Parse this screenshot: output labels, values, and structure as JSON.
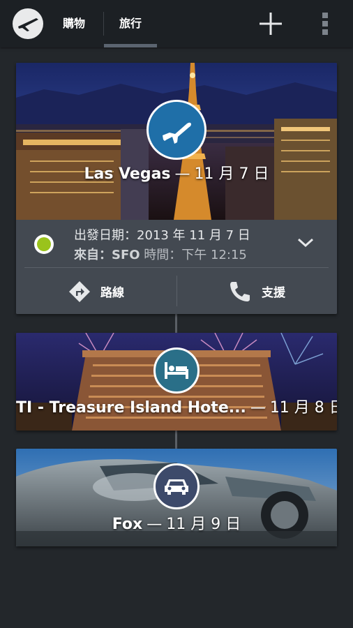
{
  "tabs": [
    {
      "label": "購物",
      "selected": false
    },
    {
      "label": "旅行",
      "selected": true
    }
  ],
  "icons": {
    "logo": "plane-globe-icon",
    "add": "plus-icon",
    "overflow": "overflow-menu-icon",
    "flight": "airplane-icon",
    "hotel": "bed-icon",
    "car": "car-icon",
    "directions": "directions-icon",
    "support": "phone-icon",
    "expand": "chevron-down-icon"
  },
  "colors": {
    "accent_blue": "#1f6fa8",
    "hotel_badge": "#2a6f88",
    "car_badge": "#3d4a6a",
    "status_green": "#9ac31c"
  },
  "trips": [
    {
      "name": "Las Vegas",
      "separator": "—",
      "date": "11 月 7 日",
      "details": {
        "line1": "出發日期：2013 年 11 月 7 日",
        "from_label": "來自：",
        "from_value": "SFO",
        "time": " 時間：下午 12:15"
      },
      "actions": {
        "directions": "路線",
        "support": "支援"
      }
    },
    {
      "name": "TI - Treasure Island Hote...",
      "separator": "—",
      "date": "11 月 8 日"
    },
    {
      "name": "Fox",
      "separator": "—",
      "date": "11 月 9 日"
    }
  ]
}
